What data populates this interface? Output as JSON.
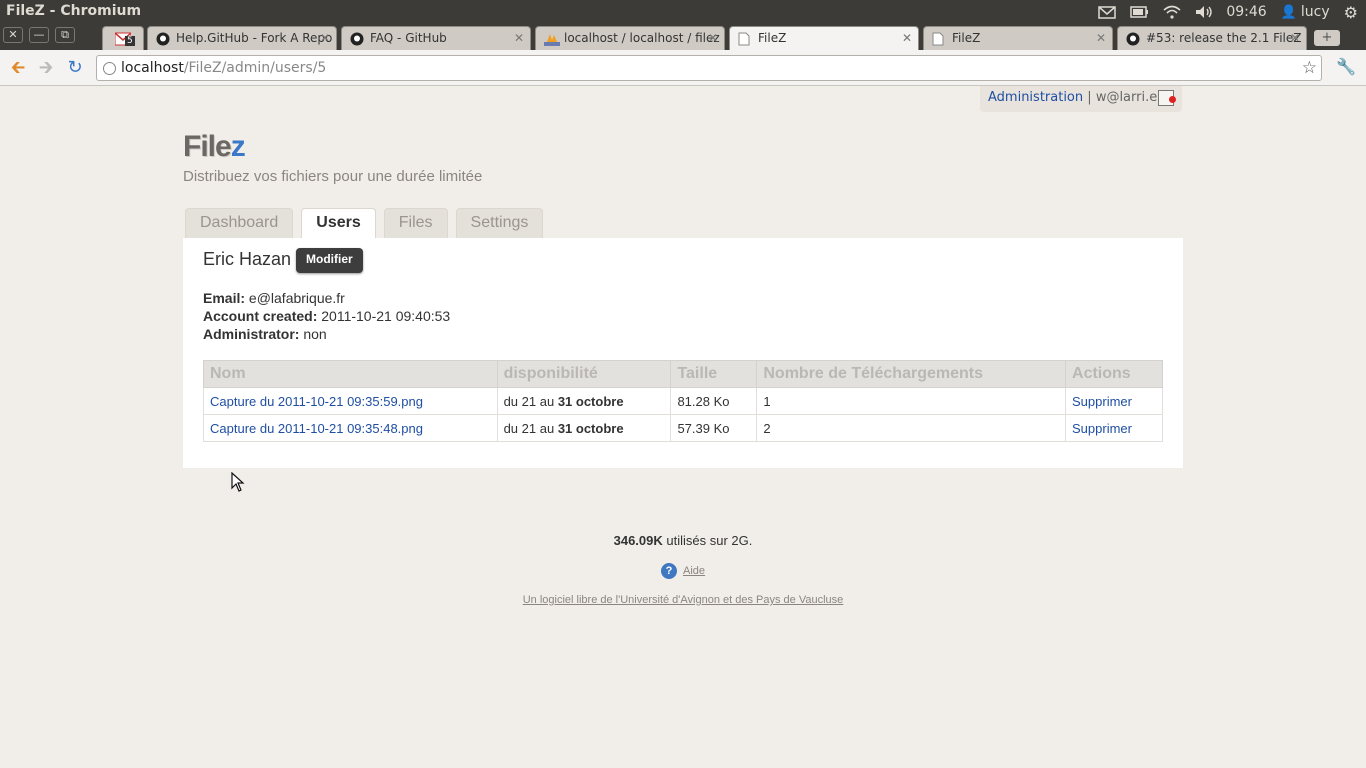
{
  "os": {
    "window_title": "FileZ - Chromium",
    "clock": "09:46",
    "user": "lucy"
  },
  "browser": {
    "tabs": [
      {
        "label": "",
        "icon": "gmail-icon",
        "badge": "5"
      },
      {
        "label": "Help.GitHub - Fork A Repo",
        "icon": "github-icon"
      },
      {
        "label": "FAQ - GitHub",
        "icon": "github-icon"
      },
      {
        "label": "localhost / localhost / filez",
        "icon": "phpmyadmin-icon"
      },
      {
        "label": "FileZ",
        "icon": "page-icon",
        "active": true
      },
      {
        "label": "FileZ",
        "icon": "page-icon"
      },
      {
        "label": "#53: release the 2.1 FileZ",
        "icon": "github-icon"
      }
    ],
    "url_host": "localhost",
    "url_path": "/FileZ/admin/users/5"
  },
  "userbar": {
    "admin_link": "Administration",
    "separator1": "|",
    "email": "w@larri.eu",
    "separator2": "|"
  },
  "header": {
    "logo_main": "File",
    "logo_accent": "z",
    "tagline": "Distribuez vos fichiers pour une durée limitée"
  },
  "nav_tabs": [
    "Dashboard",
    "Users",
    "Files",
    "Settings"
  ],
  "user": {
    "name": "Eric Hazan",
    "modify_label": "Modifier",
    "email_label": "Email:",
    "email": "e@lafabrique.fr",
    "created_label": "Account created:",
    "created": "2011-10-21 09:40:53",
    "admin_label": "Administrator:",
    "admin": "non"
  },
  "files_table": {
    "headers": [
      "Nom",
      "disponibilité",
      "Taille",
      "Nombre de Téléchargements",
      "Actions"
    ],
    "rows": [
      {
        "name": "Capture du 2011-10-21 09:35:59.png",
        "avail_prefix": "du 21 au",
        "avail_end": "31 octobre",
        "size": "81.28 Ko",
        "downloads": "1",
        "action": "Supprimer"
      },
      {
        "name": "Capture du 2011-10-21 09:35:48.png",
        "avail_prefix": "du 21 au",
        "avail_end": "31 octobre",
        "size": "57.39 Ko",
        "downloads": "2",
        "action": "Supprimer"
      }
    ]
  },
  "footer": {
    "usage_amount": "346.09K",
    "usage_text": "utilisés sur 2G.",
    "help_label": "Aide",
    "credit": "Un logiciel libre de l'Université d'Avignon et des Pays de Vaucluse"
  }
}
